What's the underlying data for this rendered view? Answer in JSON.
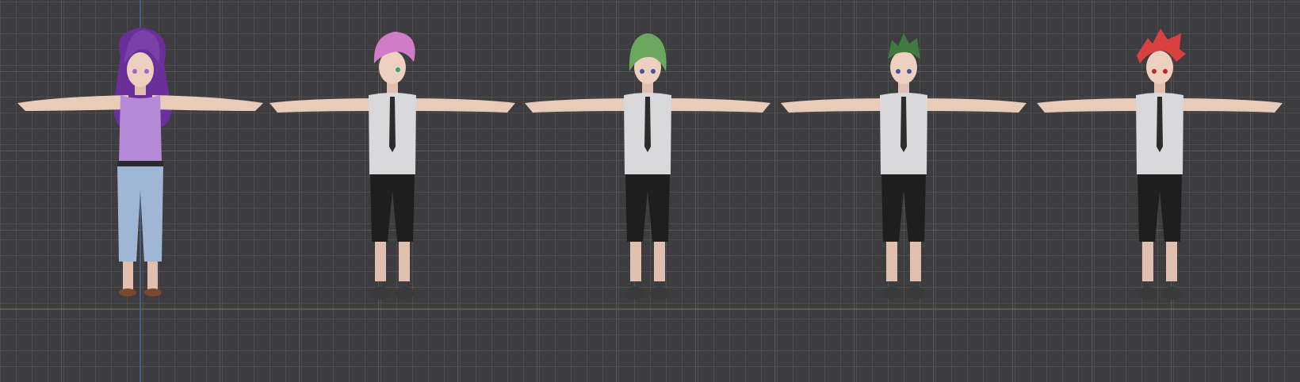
{
  "viewport": {
    "grid_color": "#5a5a5c",
    "background_color": "#3d3c3e",
    "x_axis_color": "#a33a3a",
    "y_axis_color": "#3a5fa3"
  },
  "models": [
    {
      "name": "female-character",
      "hair_color": "#7a3fa8",
      "top_color": "#b58ad6",
      "pants_color": "#9fb6d4",
      "eye_color": "#9a6bc9"
    },
    {
      "name": "male-character-pink-hair",
      "hair_color": "#d07cc8",
      "eye_color": "#2aa872"
    },
    {
      "name": "male-character-light-green-hair",
      "hair_color": "#6aa85f",
      "eye_color": "#3f5a96"
    },
    {
      "name": "male-character-dark-green-hair",
      "hair_color": "#3f7a3f",
      "eye_color": "#3f5a96"
    },
    {
      "name": "male-character-red-hair",
      "hair_color": "#d94040",
      "eye_color": "#c02828"
    }
  ]
}
